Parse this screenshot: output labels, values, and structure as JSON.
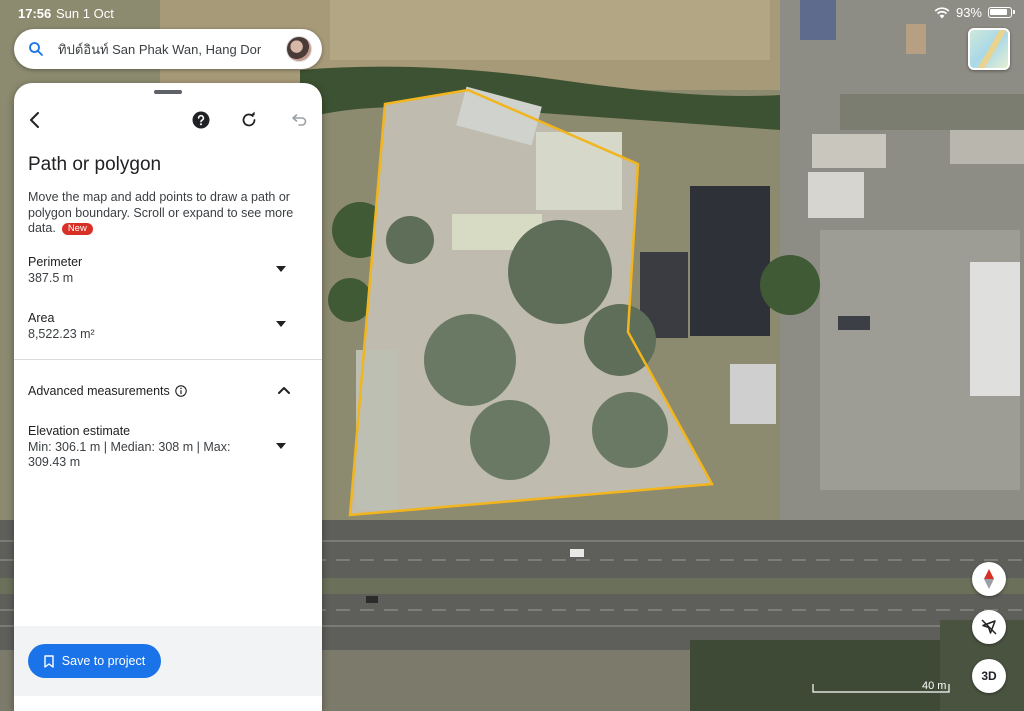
{
  "status_bar": {
    "time": "17:56",
    "date": "Sun 1 Oct",
    "battery": "93%"
  },
  "search": {
    "query": "ทิปต์อินท์ San Phak Wan, Hang Dor"
  },
  "panel": {
    "title": "Path or polygon",
    "description": "Move the map and add points to draw a path or polygon boundary. Scroll or expand to see more data.",
    "new_badge": "New",
    "perimeter": {
      "label": "Perimeter",
      "value": "387.5 m"
    },
    "area": {
      "label": "Area",
      "value": "8,522.23 m²"
    },
    "advanced": {
      "label": "Advanced measurements"
    },
    "elevation": {
      "label": "Elevation estimate",
      "value": "Min: 306.1 m | Median: 308 m | Max: 309.43 m"
    },
    "save_label": "Save to project"
  },
  "controls": {
    "three_d_label": "3D",
    "scale_label": "40 m"
  },
  "colors": {
    "accent": "#1a73e8",
    "polygon_outline": "#f2b51d",
    "new_badge": "#d93025"
  },
  "icons": [
    "search-icon",
    "back-arrow-icon",
    "help-icon",
    "refresh-icon",
    "undo-icon",
    "chevron-down-icon",
    "chevron-up-icon",
    "info-icon",
    "bookmark-icon",
    "compass-icon",
    "recenter-icon"
  ]
}
